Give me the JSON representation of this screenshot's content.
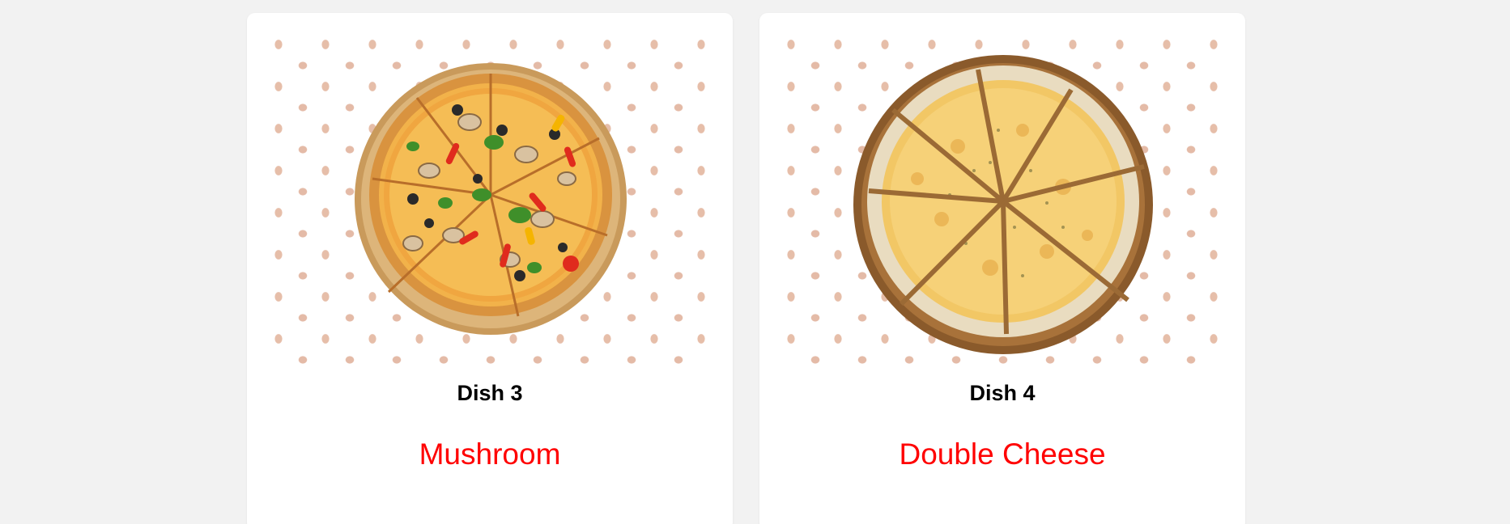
{
  "dishes": [
    {
      "name": "Dish 3",
      "type": "Mushroom",
      "image": "mushroom-pizza-image"
    },
    {
      "name": "Dish 4",
      "type": "Double Cheese",
      "image": "cheese-pizza-image"
    }
  ],
  "colors": {
    "page_background": "#f2f2f2",
    "card_background": "#ffffff",
    "dish_type_text": "#ff0000",
    "dish_name_text": "#000000"
  }
}
